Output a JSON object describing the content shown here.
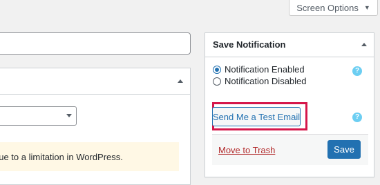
{
  "screen_options": {
    "label": "Screen Options",
    "icon": "caret-down-icon"
  },
  "left_notice": {
    "text": "due to a limitation in WordPress."
  },
  "save_box": {
    "title": "Save Notification",
    "radios": [
      {
        "label": "Notification Enabled",
        "checked": true
      },
      {
        "label": "Notification Disabled",
        "checked": false
      }
    ],
    "help_glyph": "?",
    "test_email_label": "Send Me a Test Email",
    "trash_label": "Move to Trash",
    "save_label": "Save"
  },
  "colors": {
    "accent": "#2271b1",
    "highlight": "#d5164a",
    "trash": "#b32d2e",
    "help": "#6ccef2",
    "notice_bg": "#fff8e5"
  }
}
